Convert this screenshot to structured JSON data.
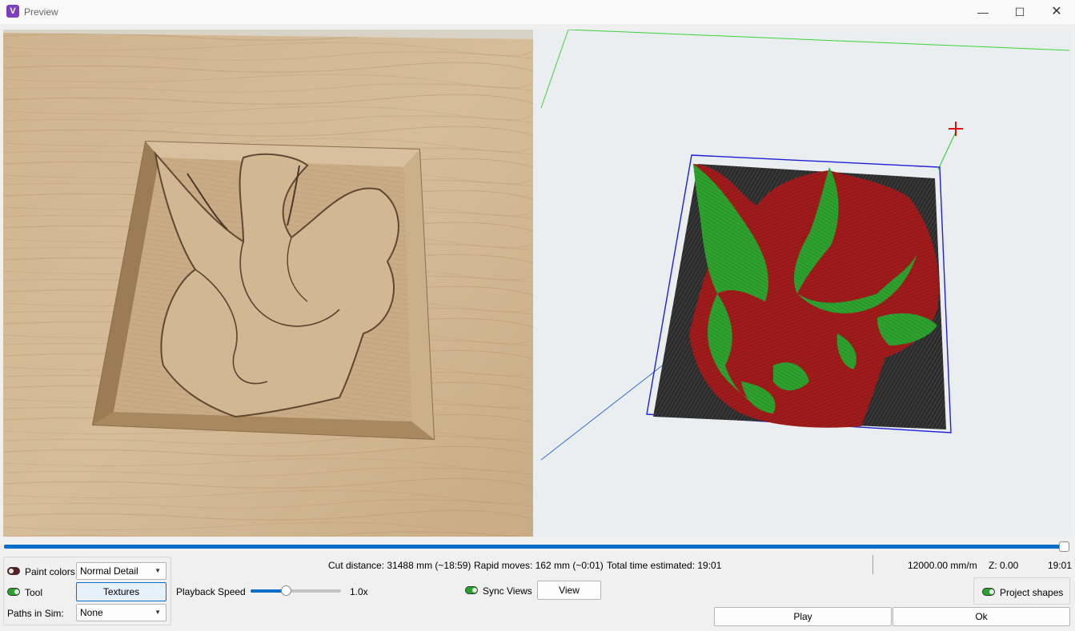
{
  "window": {
    "title": "Preview",
    "icon": "app-logo-icon",
    "min_icon": "minimize-icon",
    "max_icon": "maximize-icon",
    "close_icon": "close-icon",
    "min_glyph": "—",
    "max_glyph": "☐",
    "close_glyph": "✕"
  },
  "colors": {
    "accent": "#0a6dc8",
    "toggle_on": "#2aa32a",
    "toggle_off": "#5a1e1e",
    "toolpath_red": "#a01c1c",
    "toolpath_green": "#2ea12e",
    "bounding_box": "#1f1fd8",
    "axis_green": "#3fcf3f",
    "axis_blue": "#2a6fd0",
    "origin_marker": "#e01010"
  },
  "playback": {
    "progress": 1.0
  },
  "controls": {
    "paint_colors_label": "Paint colors",
    "paint_colors_toggle": false,
    "detail_value": "Normal Detail",
    "tool_label": "Tool",
    "tool_toggle": true,
    "textures_button": "Textures",
    "paths_in_sim_label": "Paths in Sim:",
    "paths_in_sim_value": "None",
    "playback_speed_label": "Playback Speed",
    "playback_speed_value": "1.0x",
    "playback_speed_level": 0.4,
    "sync_views_label": "Sync Views",
    "sync_views_toggle": true,
    "view_button": "View",
    "project_shapes_label": "Project shapes",
    "project_shapes_toggle": true,
    "play_button": "Play",
    "ok_button": "Ok"
  },
  "stats": {
    "cut_distance": "Cut distance: 31488 mm (~18:59)",
    "rapid_moves": "Rapid moves: 162 mm (~0:01)",
    "total_time": "Total time estimated: 19:01",
    "feed_rate": "12000.00 mm/m",
    "z_value": "Z: 0.00",
    "elapsed": "19:01"
  }
}
